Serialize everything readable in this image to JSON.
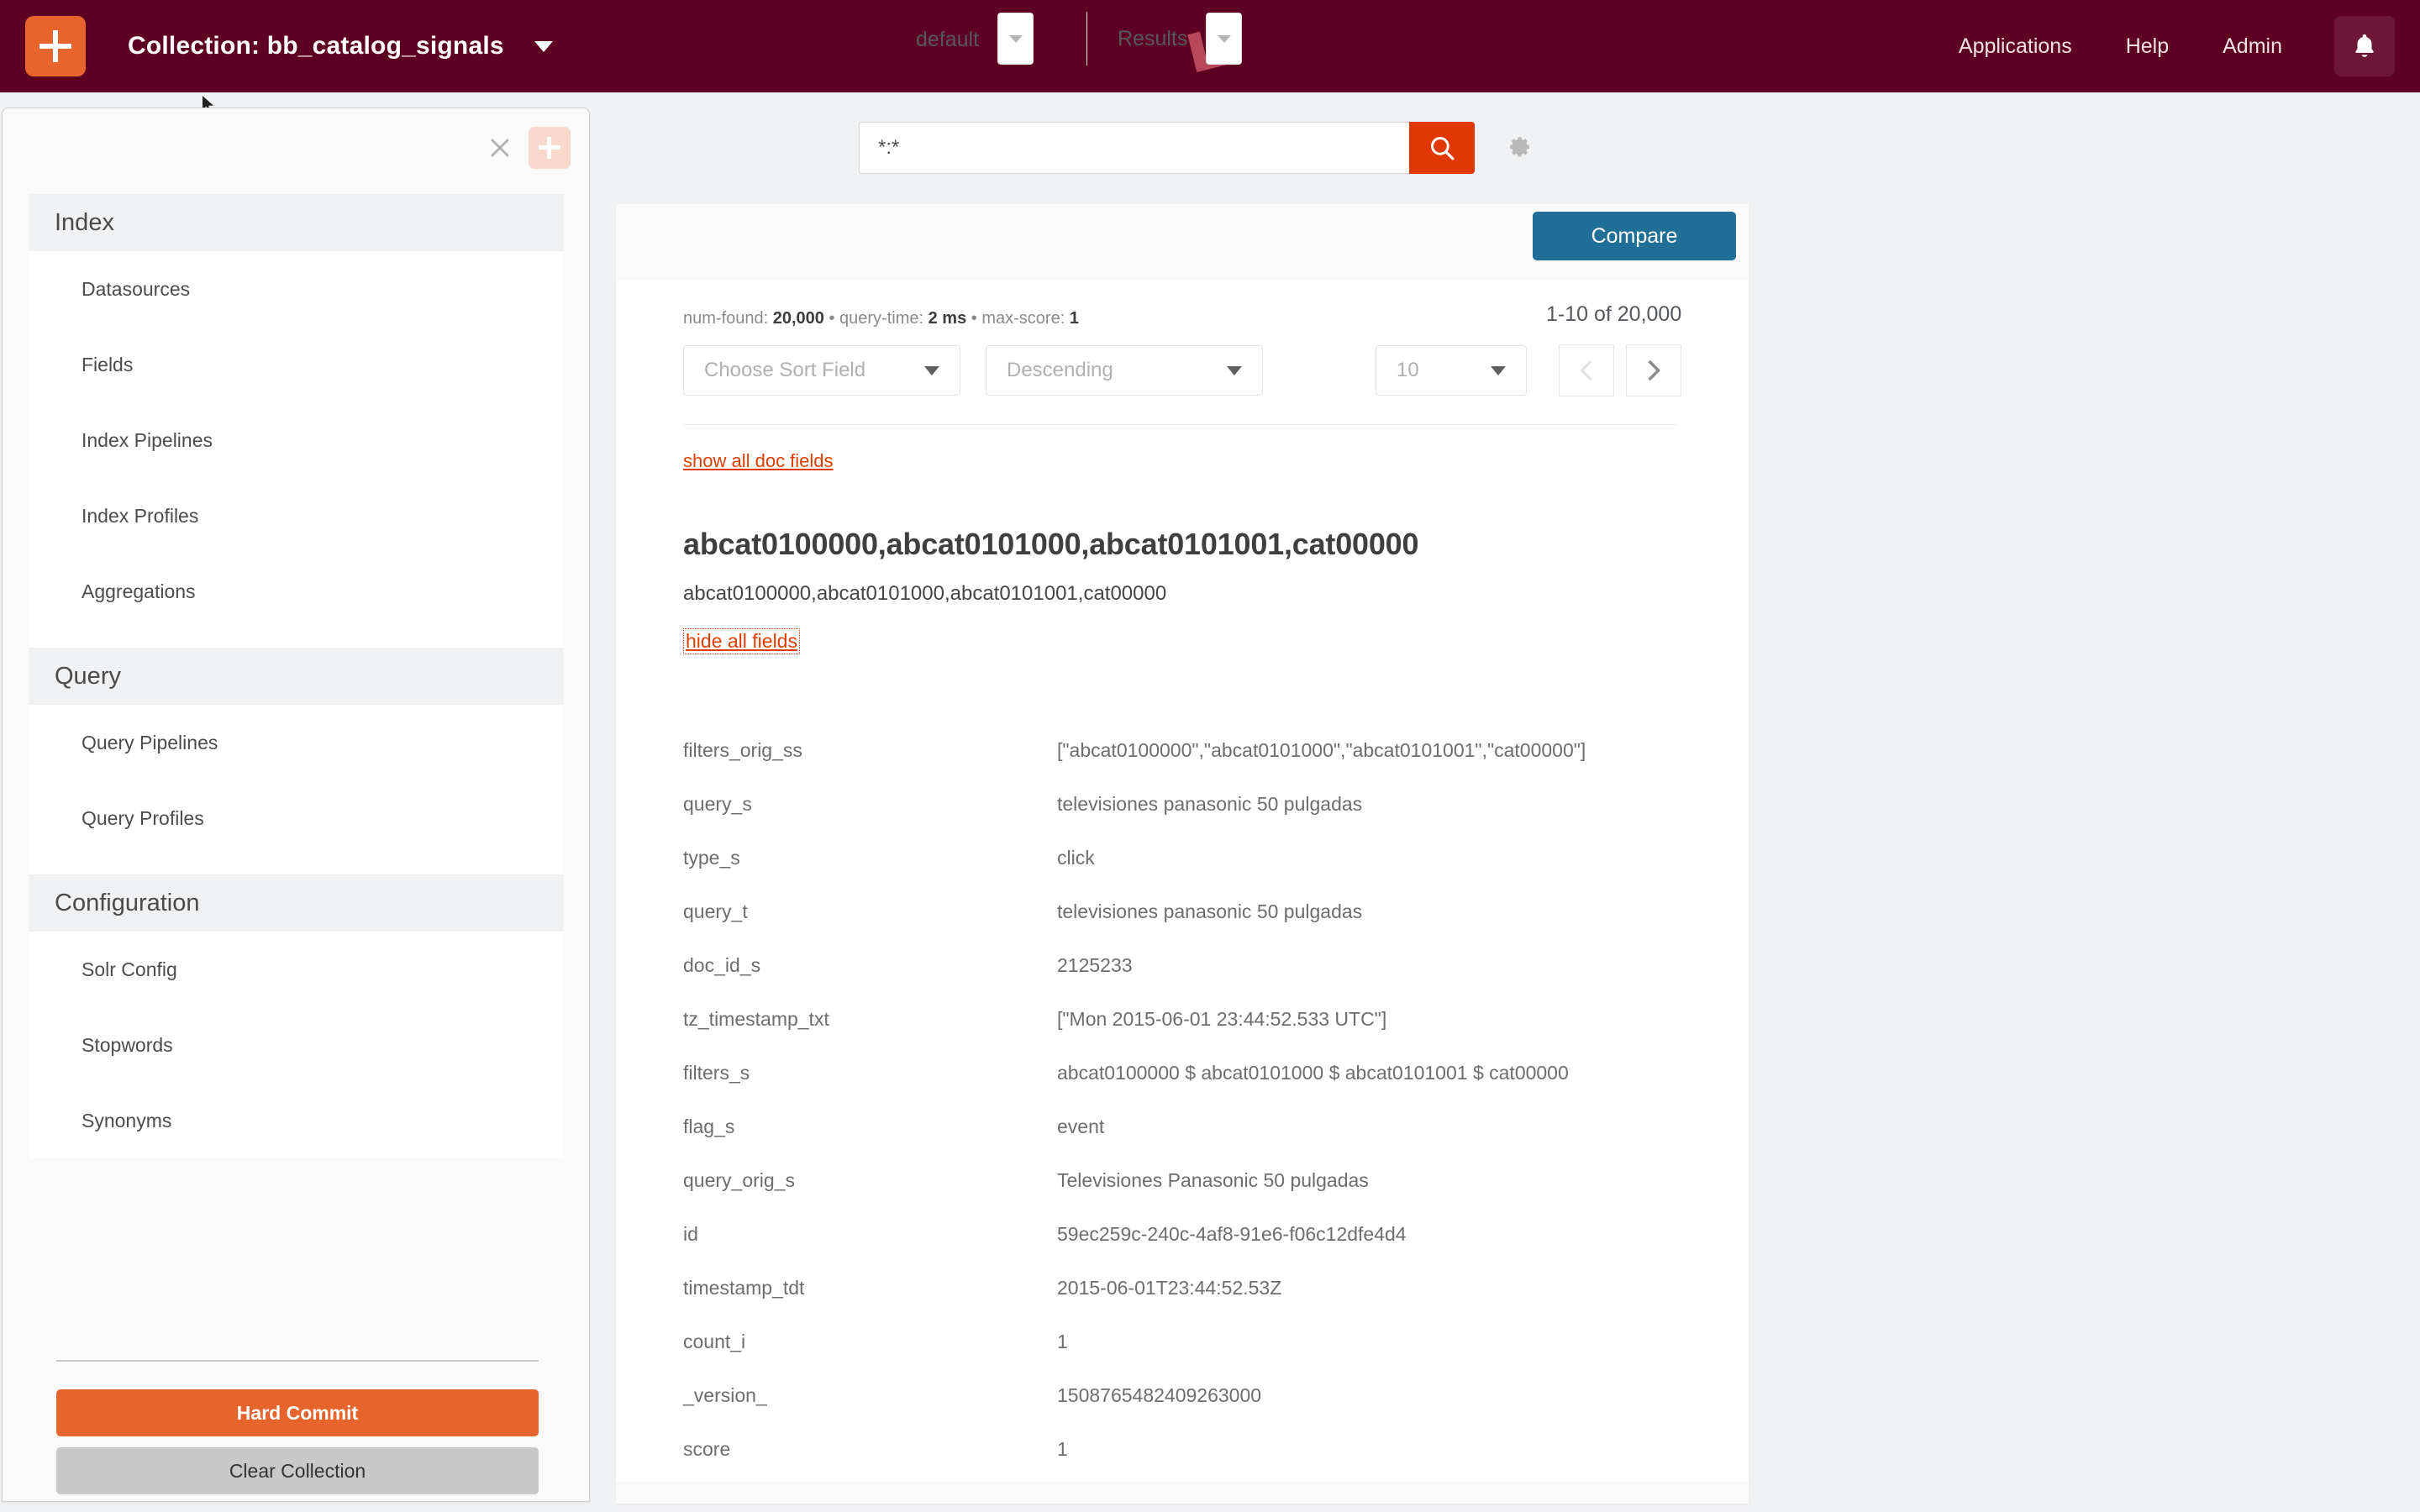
{
  "topbar": {
    "add_collection_icon": "plus-icon",
    "collection_label": "Collection: bb_catalog_signals",
    "collection_caret_icon": "chevron-down-icon",
    "brand_logo_icon": "lucidworks-logo",
    "nav": [
      {
        "label": "Applications"
      },
      {
        "label": "Help"
      },
      {
        "label": "Admin"
      }
    ],
    "notifications_icon": "bell-icon",
    "brand_color": "#5e0022",
    "accent_color": "#e8642d"
  },
  "left_panel": {
    "close_icon": "close-icon",
    "add_icon": "plus-icon",
    "groups": [
      {
        "title": "Index",
        "items": [
          {
            "label": "Datasources"
          },
          {
            "label": "Fields"
          },
          {
            "label": "Index Pipelines"
          },
          {
            "label": "Index Profiles"
          },
          {
            "label": "Aggregations"
          }
        ]
      },
      {
        "title": "Query",
        "items": [
          {
            "label": "Query Pipelines"
          },
          {
            "label": "Query Profiles"
          }
        ]
      },
      {
        "title": "Configuration",
        "items": [
          {
            "label": "Solr Config"
          },
          {
            "label": "Stopwords"
          },
          {
            "label": "Synonyms"
          }
        ]
      }
    ],
    "hard_commit_label": "Hard Commit",
    "clear_collection_label": "Clear Collection"
  },
  "search": {
    "value": "*:*",
    "placeholder": "",
    "submit_icon": "search-icon",
    "settings_icon": "gear-icon",
    "submit_color": "#e13700"
  },
  "results": {
    "toolbar": {
      "pipeline_label": "default",
      "pipeline_caret_icon": "chevron-down-icon",
      "results_label": "Results",
      "results_caret_icon": "chevron-down-icon",
      "compare_label": "Compare",
      "compare_color": "#1f6f96"
    },
    "stats": {
      "num_found_key": "num-found:",
      "num_found_value": "20,000",
      "query_time_key": "query-time:",
      "query_time_value": "2 ms",
      "max_score_key": "max-score:",
      "max_score_value": "1",
      "sep": " • "
    },
    "range_label": "1-10 of 20,000",
    "sort_field_placeholder": "Choose Sort Field",
    "sort_order_value": "Descending",
    "page_size_value": "10",
    "prev_page_icon": "chevron-left-icon",
    "next_page_icon": "chevron-right-icon",
    "show_all_doc_fields_label": "show all doc fields",
    "hide_all_fields_label": "hide all fields"
  },
  "document": {
    "title": "abcat0100000,abcat0101000,abcat0101001,cat00000",
    "subtitle": "abcat0100000,abcat0101000,abcat0101001,cat00000",
    "fields": [
      {
        "key": "filters_orig_ss",
        "value": "[\"abcat0100000\",\"abcat0101000\",\"abcat0101001\",\"cat00000\"]"
      },
      {
        "key": "query_s",
        "value": "televisiones panasonic 50 pulgadas"
      },
      {
        "key": "type_s",
        "value": "click"
      },
      {
        "key": "query_t",
        "value": "televisiones panasonic 50 pulgadas"
      },
      {
        "key": "doc_id_s",
        "value": "2125233"
      },
      {
        "key": "tz_timestamp_txt",
        "value": "[\"Mon 2015-06-01 23:44:52.533 UTC\"]"
      },
      {
        "key": "filters_s",
        "value": "abcat0100000 $ abcat0101000 $ abcat0101001 $ cat00000"
      },
      {
        "key": "flag_s",
        "value": "event"
      },
      {
        "key": "query_orig_s",
        "value": "Televisiones Panasonic 50 pulgadas"
      },
      {
        "key": "id",
        "value": "59ec259c-240c-4af8-91e6-f06c12dfe4d4"
      },
      {
        "key": "timestamp_tdt",
        "value": "2015-06-01T23:44:52.53Z"
      },
      {
        "key": "count_i",
        "value": "1"
      },
      {
        "key": "_version_",
        "value": "1508765482409263000"
      },
      {
        "key": "score",
        "value": "1"
      }
    ]
  }
}
